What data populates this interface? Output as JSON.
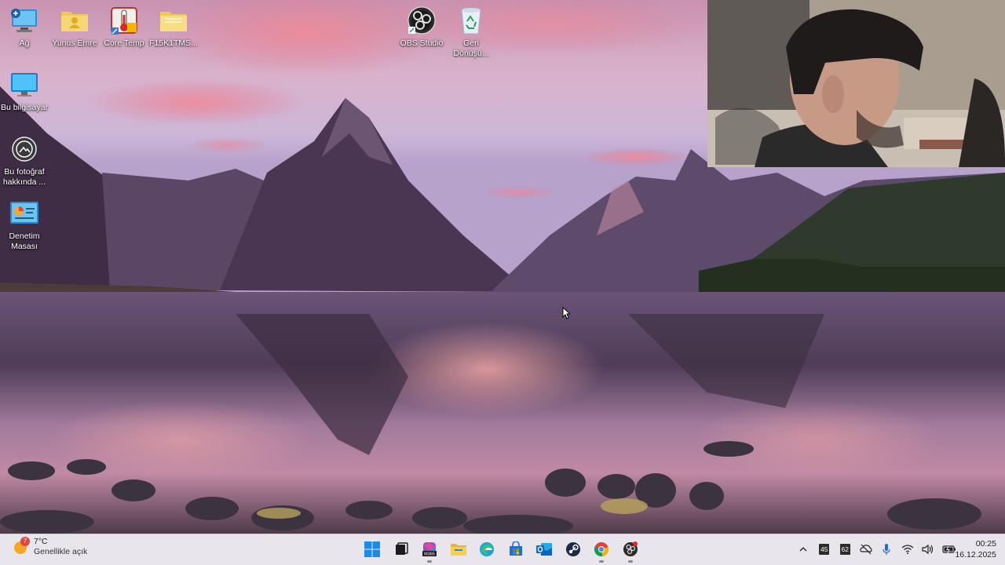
{
  "desktop": {
    "icons": [
      {
        "label": "Ağ",
        "icon": "network-icon"
      },
      {
        "label": "Yunus Emre",
        "icon": "user-folder-icon"
      },
      {
        "label": "Core Temp",
        "icon": "core-temp-icon"
      },
      {
        "label": "F15K1TMS...",
        "icon": "folder-icon"
      },
      {
        "label": "OBS Studio",
        "icon": "obs-icon"
      },
      {
        "label": "Geri Dönüşü...",
        "icon": "recycle-bin-icon"
      },
      {
        "label": "Bu bilgisayar",
        "icon": "computer-icon"
      },
      {
        "label": "Bu fotoğraf hakkında ...",
        "icon": "photo-info-icon"
      },
      {
        "label": "Denetim Masası",
        "icon": "control-panel-icon"
      }
    ]
  },
  "taskbar": {
    "weather": {
      "temp": "7°C",
      "condition": "Genellikle açık",
      "badge": "7"
    },
    "apps": [
      {
        "name": "start-button",
        "icon": "windows-icon"
      },
      {
        "name": "task-view-button",
        "icon": "task-view-icon"
      },
      {
        "name": "m365-button",
        "icon": "m365-icon",
        "badge": "M365"
      },
      {
        "name": "file-explorer-button",
        "icon": "folder-icon"
      },
      {
        "name": "edge-button",
        "icon": "edge-icon"
      },
      {
        "name": "store-button",
        "icon": "store-icon"
      },
      {
        "name": "outlook-button",
        "icon": "outlook-icon"
      },
      {
        "name": "steam-button",
        "icon": "steam-icon"
      },
      {
        "name": "chrome-button",
        "icon": "chrome-icon"
      },
      {
        "name": "obs-button",
        "icon": "obs-icon"
      }
    ],
    "tray": {
      "cpu_temp": "45",
      "gpu_temp": "62"
    },
    "clock": {
      "time": "00:25",
      "date": "16.12.2025"
    }
  }
}
